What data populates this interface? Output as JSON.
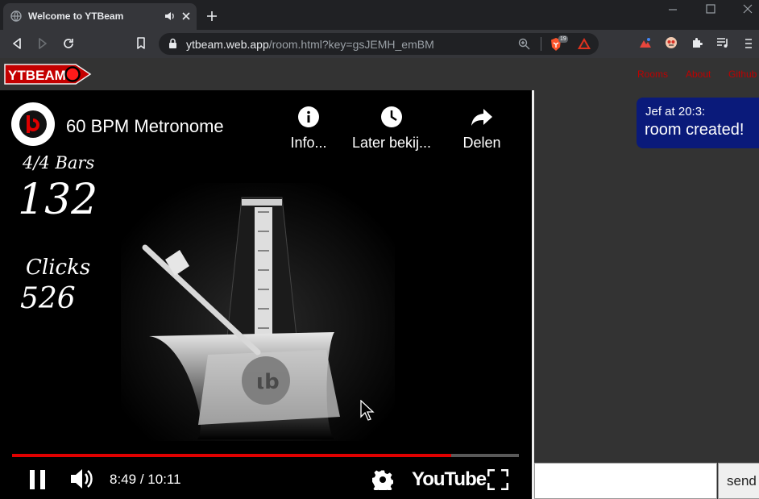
{
  "browser": {
    "tab_title": "Welcome to YTBeam",
    "url_host": "ytbeam.web.app",
    "url_path": "/room.html?key=gsJEMH_emBM",
    "brave_shield_count": "19"
  },
  "site": {
    "logo_text": "YTBEAM",
    "nav": [
      "Rooms",
      "About",
      "Github"
    ]
  },
  "video": {
    "title": "60 BPM Metronome",
    "actions": [
      "Info...",
      "Later bekij...",
      "Delen"
    ],
    "overlay_bars_label": "4/4 Bars",
    "overlay_bars_value": "132",
    "overlay_clicks_label": "Clicks",
    "overlay_clicks_value": "526",
    "time_current": "8:49",
    "time_separator": "/",
    "time_total": "10:11",
    "progress": 0.866,
    "youtube_wordmark": "YouTube"
  },
  "chat": {
    "messages": [
      {
        "author_time": "Jef at 20:3:",
        "text": "room created!"
      }
    ],
    "input_value": "",
    "send_label": "send"
  },
  "colors": {
    "accent_red": "#e00000",
    "chat_bubble": "#0a1a7a"
  }
}
